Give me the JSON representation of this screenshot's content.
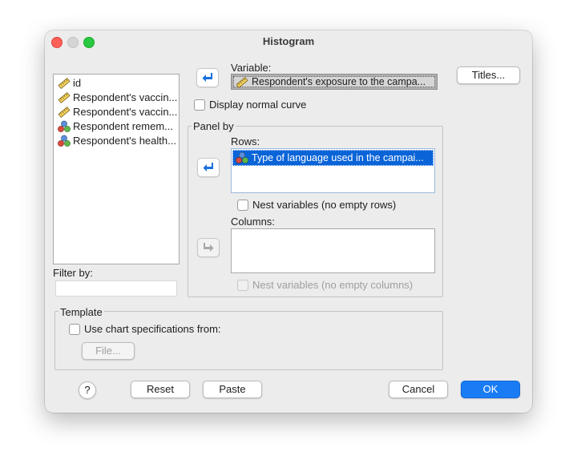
{
  "window": {
    "title": "Histogram"
  },
  "source_list": {
    "items": [
      {
        "label": "id",
        "icon": "scale-ruler-icon"
      },
      {
        "label": "Respondent's vaccin...",
        "icon": "scale-ruler-icon"
      },
      {
        "label": "Respondent's vaccin...",
        "icon": "scale-ruler-icon"
      },
      {
        "label": "Respondent remem...",
        "icon": "nominal-circles-icon"
      },
      {
        "label": "Respondent's health...",
        "icon": "nominal-circles-icon"
      }
    ]
  },
  "filter": {
    "label": "Filter by:",
    "value": ""
  },
  "variable": {
    "label": "Variable:",
    "value": "Respondent's exposure to the campa...",
    "icon": "scale-ruler-icon"
  },
  "normal_curve": {
    "label": "Display normal curve",
    "checked": false
  },
  "panel_by": {
    "title": "Panel by",
    "rows_label": "Rows:",
    "rows_items": [
      {
        "label": "Type of language used in the campai...",
        "icon": "nominal-circles-icon"
      }
    ],
    "nest_rows_label": "Nest variables (no empty rows)",
    "columns_label": "Columns:",
    "nest_columns_label": "Nest variables (no empty columns)"
  },
  "template": {
    "title": "Template",
    "use_spec_label": "Use chart specifications from:",
    "file_button": "File..."
  },
  "buttons": {
    "titles": "Titles...",
    "help": "?",
    "reset": "Reset",
    "paste": "Paste",
    "cancel": "Cancel",
    "ok": "OK"
  },
  "colors": {
    "accent": "#1a7cf5",
    "selection": "#0a64d8",
    "window_bg": "#ececec",
    "arrow_blue": "#1a6fe0"
  }
}
